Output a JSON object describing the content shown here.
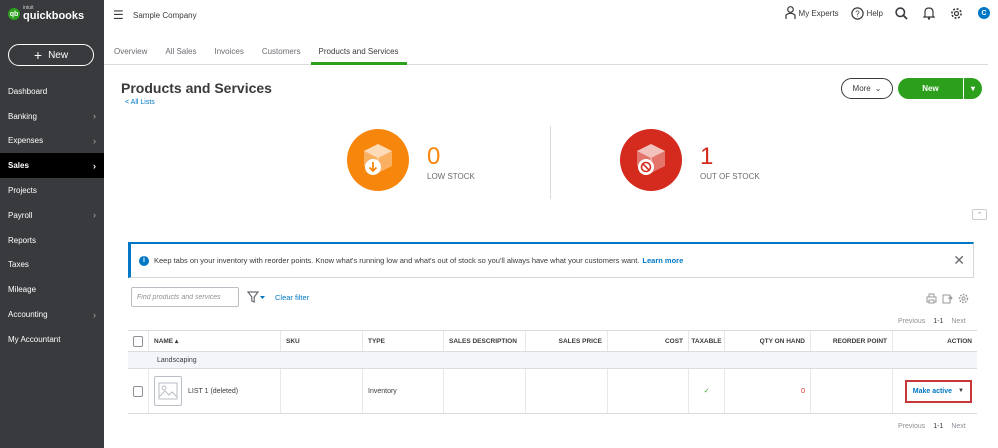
{
  "app": {
    "logo_small": "intuit",
    "logo_big": "quickbooks",
    "company": "Sample Company",
    "new_button": "New"
  },
  "sidebar": {
    "items": [
      {
        "label": "Dashboard",
        "chevron": false,
        "active": false
      },
      {
        "label": "Banking",
        "chevron": true,
        "active": false
      },
      {
        "label": "Expenses",
        "chevron": true,
        "active": false
      },
      {
        "label": "Sales",
        "chevron": true,
        "active": true
      },
      {
        "label": "Projects",
        "chevron": false,
        "active": false
      },
      {
        "label": "Payroll",
        "chevron": true,
        "active": false
      },
      {
        "label": "Reports",
        "chevron": false,
        "active": false
      },
      {
        "label": "Taxes",
        "chevron": false,
        "active": false
      },
      {
        "label": "Mileage",
        "chevron": false,
        "active": false
      },
      {
        "label": "Accounting",
        "chevron": true,
        "active": false
      },
      {
        "label": "My Accountant",
        "chevron": false,
        "active": false
      }
    ]
  },
  "topbar": {
    "my_experts": "My Experts",
    "help": "Help",
    "avatar_initial": "C"
  },
  "tabs": [
    {
      "label": "Overview",
      "active": false
    },
    {
      "label": "All Sales",
      "active": false
    },
    {
      "label": "Invoices",
      "active": false
    },
    {
      "label": "Customers",
      "active": false
    },
    {
      "label": "Products and Services",
      "active": true
    }
  ],
  "page": {
    "title": "Products and Services",
    "back_link": "< All Lists",
    "more_button": "More",
    "new_button": "New"
  },
  "stock": {
    "low": {
      "count": "0",
      "label": "LOW STOCK",
      "color": "#f7860d"
    },
    "out": {
      "count": "1",
      "label": "OUT OF STOCK",
      "color": "#d52b1e"
    }
  },
  "banner": {
    "text": "Keep tabs on your inventory with reorder points. Know what's running low and what's out of stock so you'll always have what your customers want.",
    "link": "Learn more"
  },
  "filter": {
    "search_placeholder": "Find products and services",
    "clear_filter": "Clear filter"
  },
  "pager": {
    "previous": "Previous",
    "range": "1-1",
    "next": "Next"
  },
  "table": {
    "headers": {
      "name": "NAME",
      "sku": "SKU",
      "type": "TYPE",
      "sales_description": "SALES DESCRIPTION",
      "sales_price": "SALES PRICE",
      "cost": "COST",
      "taxable": "TAXABLE",
      "qty_on_hand": "QTY ON HAND",
      "reorder_point": "REORDER POINT",
      "action": "ACTION"
    },
    "group": "Landscaping",
    "rows": [
      {
        "name": "LIST 1 (deleted)",
        "sku": "",
        "type": "Inventory",
        "sales_description": "",
        "sales_price": "",
        "cost": "",
        "taxable": "✓",
        "qty_on_hand": "0",
        "reorder_point": "",
        "action": "Make active"
      }
    ]
  },
  "colors": {
    "sidebar_bg": "#393a3d",
    "accent_green": "#2ca01c",
    "link_blue": "#0077c5",
    "highlight_red": "#c7373a"
  }
}
